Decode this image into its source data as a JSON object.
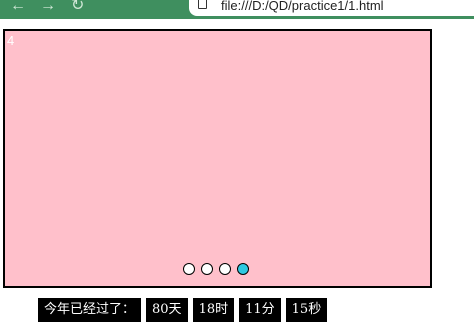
{
  "browser": {
    "back_icon": "←",
    "forward_icon": "→",
    "refresh_icon": "↻",
    "url": "file:///D:/QD/practice1/1.html"
  },
  "carousel": {
    "slide_number": "4",
    "background": "#ffc0cb",
    "dot_active_color": "#2ec8e0",
    "active_index": 3,
    "dot_count": 4
  },
  "countdown": {
    "label": "今年已经过了：",
    "days": "80天",
    "hours": "18时",
    "minutes": "11分",
    "seconds": "15秒"
  }
}
